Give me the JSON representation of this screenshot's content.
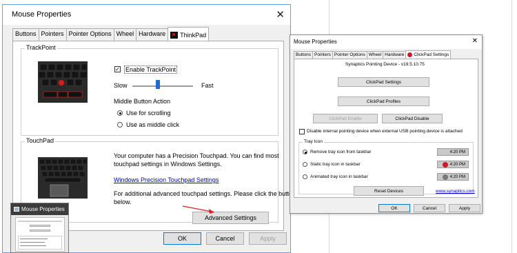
{
  "dialog1": {
    "title": "Mouse Properties",
    "tabs": [
      "Buttons",
      "Pointers",
      "Pointer Options",
      "Wheel",
      "Hardware",
      "ThinkPad"
    ],
    "trackpoint": {
      "group_title": "TrackPoint",
      "enable_label": "Enable TrackPoint",
      "enabled": true,
      "slow": "Slow",
      "fast": "Fast",
      "middle_action": "Middle Button Action",
      "options": [
        "Use for scrolling",
        "Use as middle click"
      ],
      "selected_option": 0
    },
    "touchpad": {
      "group_title": "TouchPad",
      "text1": "Your computer has a Precision Touchpad. You can find most",
      "text2": "touchpad settings in Windows Settings.",
      "link": "Windows Precision Touchpad Settings",
      "text3": "For additional advanced touchpad settings. Please click the button",
      "text4": "below.",
      "advanced_button": "Advanced Settings"
    },
    "buttons": {
      "ok": "OK",
      "cancel": "Cancel",
      "apply": "Apply"
    }
  },
  "dialog2": {
    "title": "Mouse Properties",
    "tabs": [
      "Buttons",
      "Pointers",
      "Pointer Options",
      "Wheel",
      "Hardware",
      "ClickPad Settings"
    ],
    "device": "Synaptics Pointing Device - v19.5.10.75",
    "buttons": {
      "clickpad_settings": "ClickPad Settings",
      "clickpad_profiles": "ClickPad Profiles",
      "clickpad_enable": "ClickPad Enable",
      "clickpad_disable": "ClickPad Disable",
      "reset": "Reset Devices",
      "ok": "OK",
      "cancel": "Cancel",
      "apply": "Apply"
    },
    "disable_internal": "Disable internal pointing device when external USB pointing device is attached",
    "tray": {
      "title": "Tray Icon",
      "options": [
        "Remove tray icon from taskbar",
        "Static tray icon in taskbar",
        "Animated tray icon in taskbar"
      ],
      "selected": 0,
      "time": "4:20 PM"
    },
    "link": "www.synaptics.com"
  },
  "thumbnail": {
    "title": "Mouse Properties"
  }
}
